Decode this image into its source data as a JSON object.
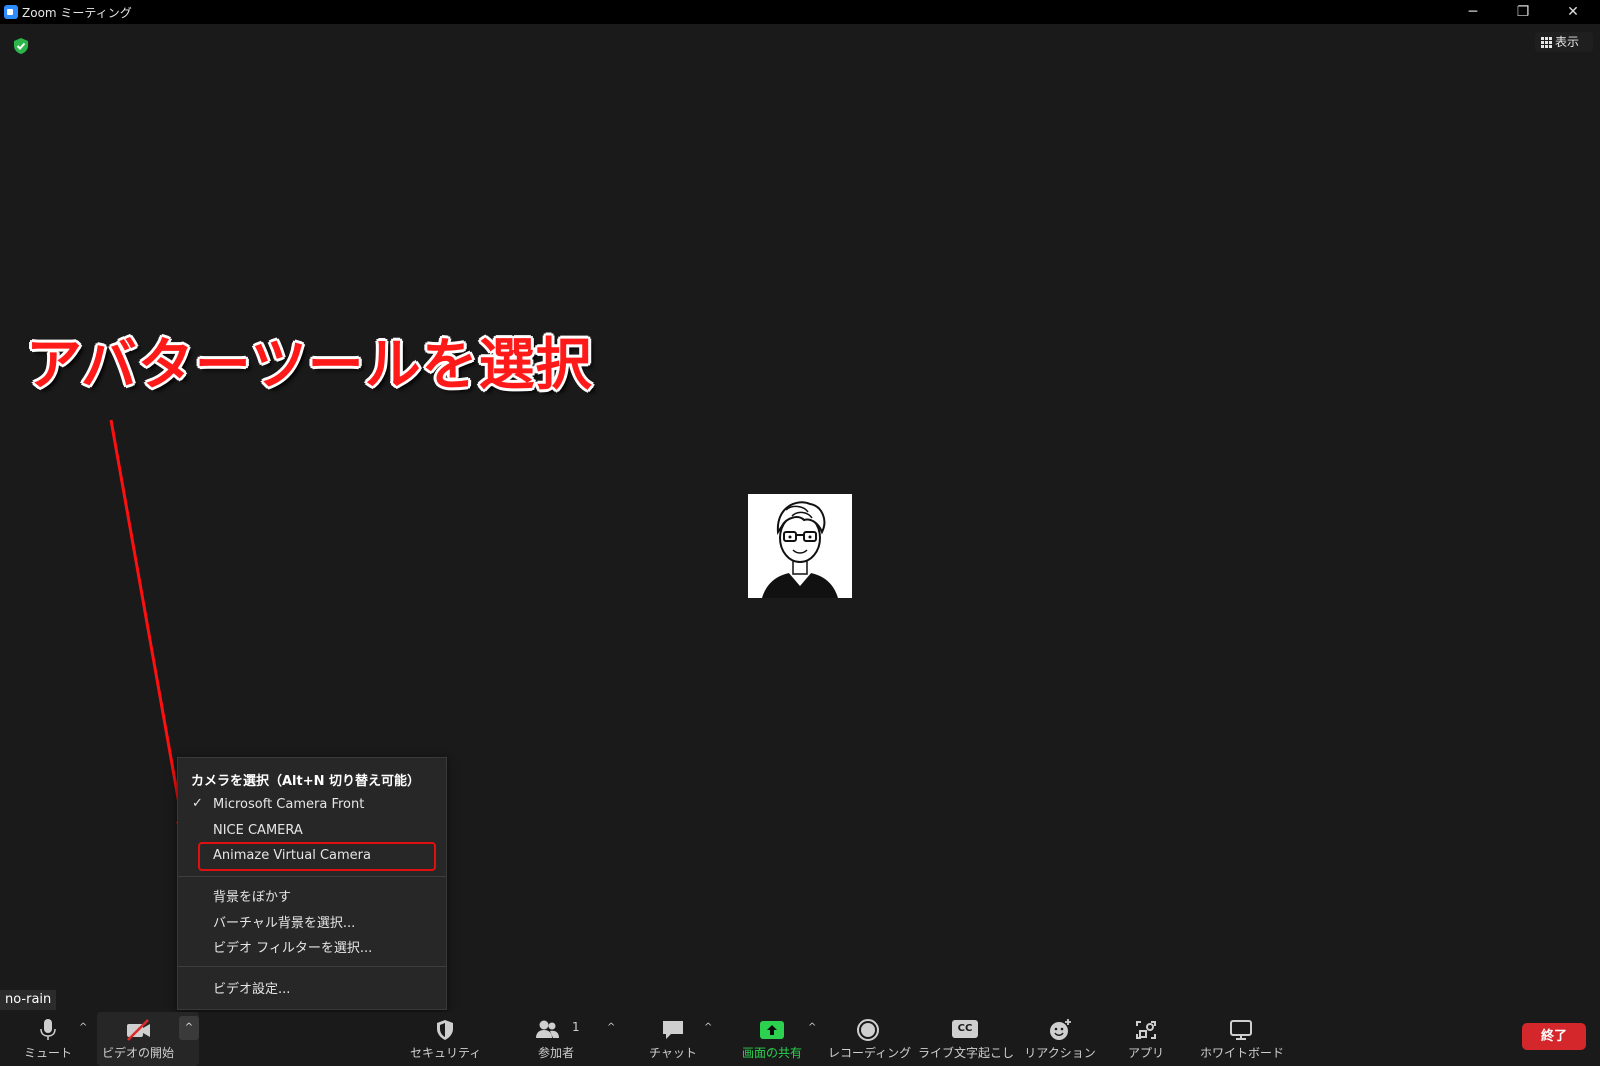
{
  "window": {
    "title": "Zoom ミーティング",
    "controls": {
      "minimize": "─",
      "maximize": "❐",
      "close": "✕"
    }
  },
  "view_button": {
    "label": "表示"
  },
  "annotation": {
    "text": "アバターツールを選択"
  },
  "camera_menu": {
    "header": "カメラを選択（Alt+N 切り替え可能）",
    "cameras": [
      {
        "label": "Microsoft Camera Front",
        "checked": true
      },
      {
        "label": "NICE CAMERA",
        "checked": false
      },
      {
        "label": "Animaze Virtual Camera",
        "checked": false
      }
    ],
    "check_mark": "✓",
    "background_options": [
      "背景をぼかす",
      "バーチャル背景を選択...",
      "ビデオ フィルターを選択..."
    ],
    "settings": "ビデオ設定..."
  },
  "tooltip": {
    "text": "no-rain"
  },
  "toolbar": {
    "mute": {
      "label": "ミュート",
      "icon": "microphone-icon"
    },
    "video": {
      "label": "ビデオの開始",
      "icon": "video-off-icon"
    },
    "security": {
      "label": "セキュリティ",
      "icon": "shield-icon"
    },
    "participants": {
      "label": "参加者",
      "count": "1",
      "icon": "participants-icon"
    },
    "chat": {
      "label": "チャット",
      "icon": "chat-icon"
    },
    "share": {
      "label": "画面の共有",
      "icon": "share-screen-icon",
      "color": "#2bd14f"
    },
    "record": {
      "label": "レコーディング",
      "icon": "record-icon"
    },
    "captions": {
      "label": "ライブ文字起こし",
      "icon_text": "CC"
    },
    "reactions": {
      "label": "リアクション",
      "icon": "reaction-icon"
    },
    "apps": {
      "label": "アプリ",
      "icon": "apps-icon"
    },
    "whiteboard": {
      "label": "ホワイトボード",
      "icon": "whiteboard-icon"
    },
    "end": {
      "label": "終了",
      "color": "#d3272c"
    },
    "caret": "^"
  }
}
